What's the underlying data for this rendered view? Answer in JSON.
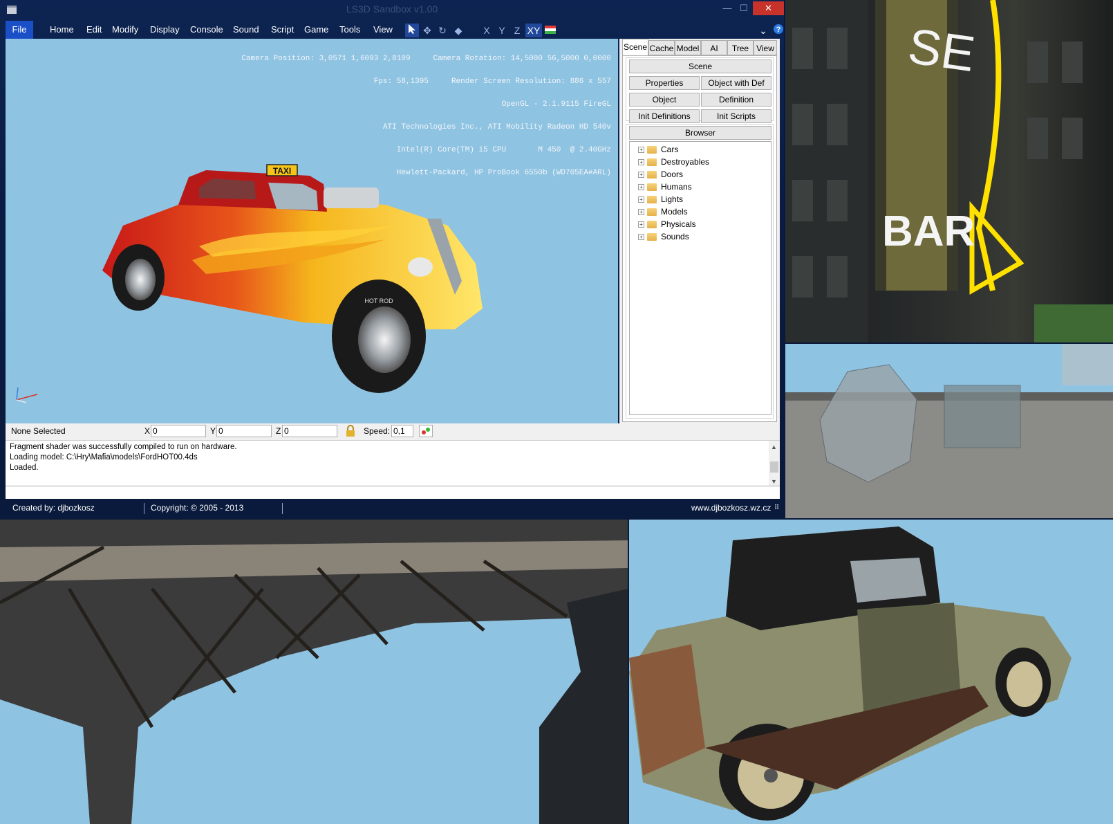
{
  "window": {
    "title": "LS3D Sandbox v1.00",
    "close_glyph": "✕",
    "min_glyph": "—",
    "max_glyph": "☐"
  },
  "menu": [
    "File",
    "Home",
    "Edit",
    "Modify",
    "Display",
    "Console",
    "Sound",
    "Script",
    "Game",
    "Tools",
    "View"
  ],
  "toolbar": {
    "axes": [
      "X",
      "Y",
      "Z",
      "XY"
    ],
    "tools": [
      "select-arrow-icon",
      "move-icon",
      "rotate-icon",
      "scale-icon",
      "flag-icon",
      "chevron-down-icon",
      "help-icon"
    ]
  },
  "viewport": {
    "info_lines": [
      "Camera Position: 3,0571 1,6093 2,8109     Camera Rotation: 14,5000 56,5000 0,0000",
      "Fps: 58,1395     Render Screen Resolution: 886 x 557",
      "OpenGL - 2.1.9115 FireGL",
      "ATI Technologies Inc., ATI Mobility Radeon HD 540v",
      "Intel(R) Core(TM) i5 CPU       M 450  @ 2.40GHz",
      "Hewlett-Packard, HP ProBook 6550b (WD705EA#ARL)"
    ],
    "taxi_sign": "TAXI",
    "tire_text": "HOT ROD"
  },
  "panel": {
    "tabs": [
      "Scene",
      "Cache",
      "Model",
      "AI",
      "Tree",
      "View"
    ],
    "selected_tab": "Scene",
    "scene_header": "Scene",
    "buttons": [
      "Properties",
      "Object with Def",
      "Object",
      "Definition",
      "Init Definitions",
      "Init Scripts"
    ],
    "browser_header": "Browser",
    "tree": [
      "Cars",
      "Destroyables",
      "Doors",
      "Humans",
      "Lights",
      "Models",
      "Physicals",
      "Sounds"
    ]
  },
  "status": {
    "selection": "None Selected",
    "x_label": "X",
    "x_value": "0",
    "y_label": "Y",
    "y_value": "0",
    "z_label": "Z",
    "z_value": "0",
    "speed_label": "Speed:",
    "speed_value": "0,1"
  },
  "log": [
    "Fragment shader was successfully compiled to run on hardware.",
    "Loading model: C:\\Hry\\Mafia\\models\\FordHOT00.4ds",
    "Loaded."
  ],
  "footer": {
    "created": "Created by: djbozkosz",
    "copyright": "Copyright: © 2005 - 2013",
    "website": "www.djbozkosz.wz.cz"
  },
  "neon_sign": {
    "letters": "SE",
    "bar": "BAR"
  },
  "colors": {
    "accent": "#1a4fc7",
    "viewport_sky": "#8fc3e2",
    "close_red": "#c7332b",
    "neon_yellow": "#ffe100"
  }
}
